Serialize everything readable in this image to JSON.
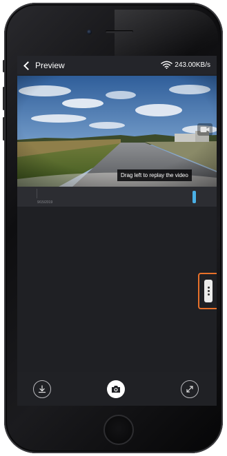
{
  "header": {
    "back_label": "Preview",
    "network_speed": "243.00KB/s",
    "wifi_icon": "wifi-icon"
  },
  "video": {
    "camera_switch_icon": "video-camera-icon",
    "tooltip": "Drag left to replay the video"
  },
  "timeline": {
    "date_label": "9/15/2019"
  },
  "side_handle": {
    "icon": "more-vertical-icon",
    "accent_color": "#e8712a"
  },
  "toolbar": {
    "download_icon": "download-icon",
    "snapshot_icon": "camera-icon",
    "fullscreen_icon": "expand-icon"
  },
  "colors": {
    "playhead": "#4ab0e6",
    "background": "#202125"
  }
}
